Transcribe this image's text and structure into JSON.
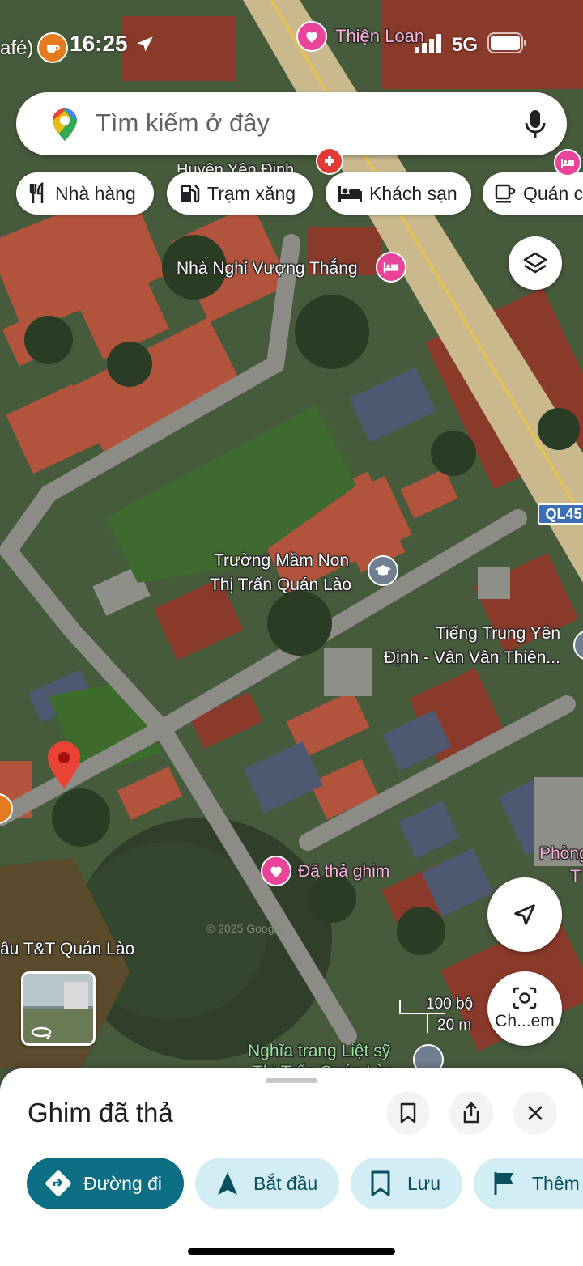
{
  "status_bar": {
    "left_fragment": "afé)",
    "time": "16:25",
    "carrier_label": "Thiện Loan",
    "network": "5G"
  },
  "search": {
    "placeholder": "Tìm kiếm ở đây"
  },
  "chips": [
    {
      "label": "Nhà hàng",
      "icon": "fork-knife-icon"
    },
    {
      "label": "Trạm xăng",
      "icon": "gas-station-icon"
    },
    {
      "label": "Khách sạn",
      "icon": "bed-icon"
    },
    {
      "label": "Quán c",
      "icon": "coffee-icon"
    }
  ],
  "map_labels": {
    "top_partial": "Huyện Yên Định",
    "guesthouse": "Nhà Nghỉ Vượng Thắng",
    "highway": "QL45",
    "school_line1": "Trường Mầm Non",
    "school_line2": "Thị Trấn Quán Lào",
    "chinese_line1": "Tiếng Trung Yên",
    "chinese_line2": "Định - Vân Vân Thiên...",
    "dropped_pin": "Đã thả ghim",
    "left_place": "âu T&T Quán Lào",
    "right_place_1": "Phòng",
    "right_place_2": "T",
    "cemetery_line1": "Nghĩa trang Liệt sỹ",
    "cemetery_line2": "Thị Trấn Quán Lào",
    "watermark": "© 2025 Google"
  },
  "scale": {
    "imperial": "100 bộ",
    "metric": "20 m"
  },
  "lens_label": "Ch...em",
  "sheet": {
    "title": "Ghim đã thả",
    "actions": [
      {
        "label": "Đường đi"
      },
      {
        "label": "Bắt đầu"
      },
      {
        "label": "Lưu"
      },
      {
        "label": "Thêm"
      }
    ]
  },
  "colors": {
    "accent_teal": "#0b6e82",
    "chip_light": "#d3edf5",
    "pin_red": "#ea4335",
    "pink_poi": "#e8459a"
  }
}
